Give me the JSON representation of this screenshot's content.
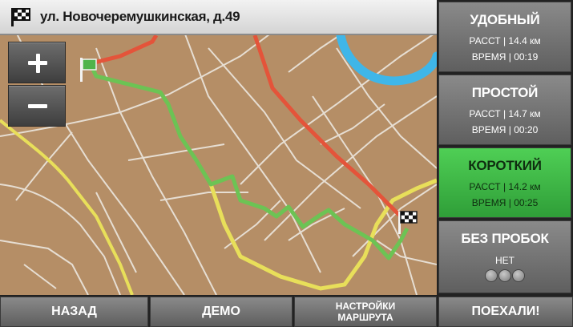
{
  "address": {
    "text": "ул. Новочеремушкинская, д.49",
    "icon": "checkered-flag-icon"
  },
  "zoom": {
    "in_icon": "plus-icon",
    "out_icon": "minus-icon"
  },
  "routes": [
    {
      "name": "УДОБНЫЙ",
      "distance": "РАССТ | 14.4 км",
      "time": "ВРЕМЯ | 00:19",
      "active": false
    },
    {
      "name": "ПРОСТОЙ",
      "distance": "РАССТ | 14.7 км",
      "time": "ВРЕМЯ | 00:20",
      "active": false
    },
    {
      "name": "КОРОТКИЙ",
      "distance": "РАССТ | 14.2 км",
      "time": "ВРЕМЯ | 00:25",
      "active": true
    }
  ],
  "traffic": {
    "name": "БЕЗ ПРОБОК",
    "status": "НЕТ"
  },
  "bottom": {
    "back": "НАЗАД",
    "demo": "ДЕМО",
    "settings_line1": "НАСТРОЙКИ",
    "settings_line2": "МАРШРУТА",
    "go": "ПОЕХАЛИ!"
  },
  "colors": {
    "map_bg": "#b58e66",
    "route_red": "#e4543a",
    "route_green": "#6cc354",
    "route_yellow": "#e8df5a",
    "water": "#3fb6e8",
    "active_route": "#3db845"
  }
}
